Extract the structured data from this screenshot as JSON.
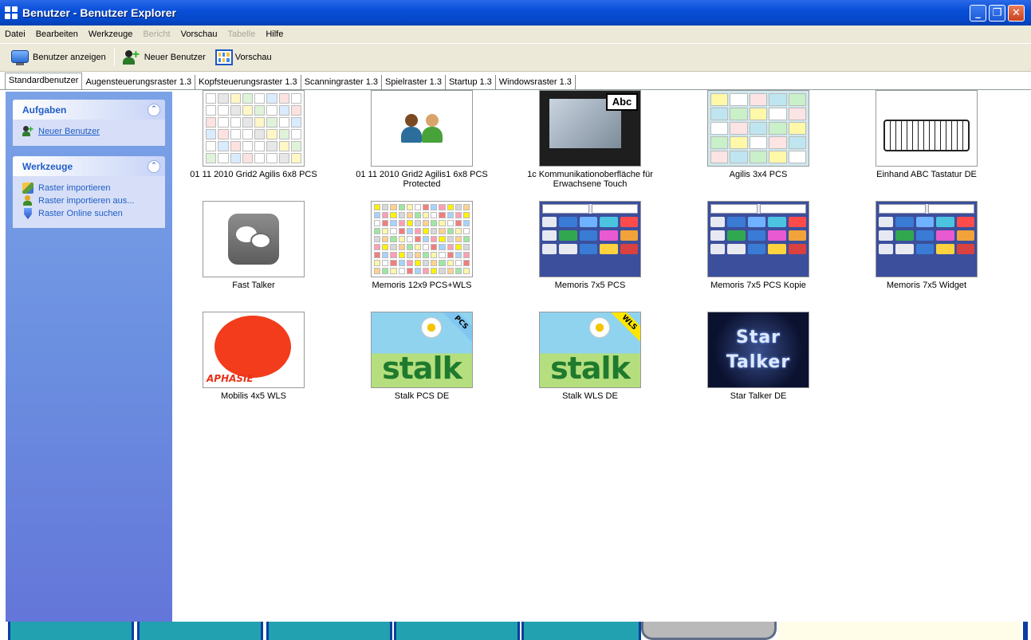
{
  "window": {
    "title": "Benutzer - Benutzer Explorer",
    "controls": {
      "minimize": "_",
      "restore": "❐",
      "close": "✕"
    }
  },
  "menu": {
    "items": [
      {
        "label": "Datei",
        "enabled": true
      },
      {
        "label": "Bearbeiten",
        "enabled": true
      },
      {
        "label": "Werkzeuge",
        "enabled": true
      },
      {
        "label": "Bericht",
        "enabled": false
      },
      {
        "label": "Vorschau",
        "enabled": true
      },
      {
        "label": "Tabelle",
        "enabled": false
      },
      {
        "label": "Hilfe",
        "enabled": true
      }
    ]
  },
  "toolbar": {
    "show_users": "Benutzer anzeigen",
    "new_user": "Neuer Benutzer",
    "preview": "Vorschau"
  },
  "tabs": [
    "Standardbenutzer",
    "Augensteuerungsraster 1.3",
    "Kopfsteuerungsraster 1.3",
    "Scanningraster 1.3",
    "Spielraster 1.3",
    "Startup 1.3",
    "Windowsraster 1.3"
  ],
  "sidebar": {
    "tasks": {
      "title": "Aufgaben",
      "collapse": "⌃",
      "items": [
        "Neuer Benutzer"
      ]
    },
    "tools": {
      "title": "Werkzeuge",
      "collapse": "⌃",
      "items": [
        "Raster importieren",
        "Raster importieren aus...",
        "Raster Online suchen"
      ]
    }
  },
  "grids": [
    {
      "caption": "01 11 2010 Grid2 Agilis 6x8 PCS",
      "thumb": "grid-6x8"
    },
    {
      "caption": "01 11 2010 Grid2 Agilis1 6x8 PCS Protected",
      "thumb": "users"
    },
    {
      "caption": "1c Kommunikationoberfläche für Erwachsene   Touch",
      "thumb": "touch",
      "badge": "Abc"
    },
    {
      "caption": "Agilis 3x4 PCS",
      "thumb": "agilis"
    },
    {
      "caption": "Einhand  ABC Tastatur DE",
      "thumb": "keyboard"
    },
    {
      "caption": "Fast Talker",
      "thumb": "fast-talker"
    },
    {
      "caption": "Memoris 12x9 PCS+WLS",
      "thumb": "grid-12x9"
    },
    {
      "caption": "Memoris 7x5 PCS",
      "thumb": "memoris"
    },
    {
      "caption": "Memoris 7x5 PCS Kopie",
      "thumb": "memoris"
    },
    {
      "caption": "Memoris 7x5 Widget",
      "thumb": "memoris"
    },
    {
      "caption": "Mobilis 4x5 WLS",
      "thumb": "aphasie",
      "badge": "APHASIE"
    },
    {
      "caption": "Stalk PCS DE",
      "thumb": "stalk",
      "badge": "PCS",
      "word": "stalk"
    },
    {
      "caption": "Stalk WLS DE",
      "thumb": "stalk",
      "badge": "WLS",
      "word": "stalk"
    },
    {
      "caption": "Star Talker DE",
      "thumb": "star-talker",
      "words": [
        "Star",
        "Talker"
      ]
    }
  ]
}
